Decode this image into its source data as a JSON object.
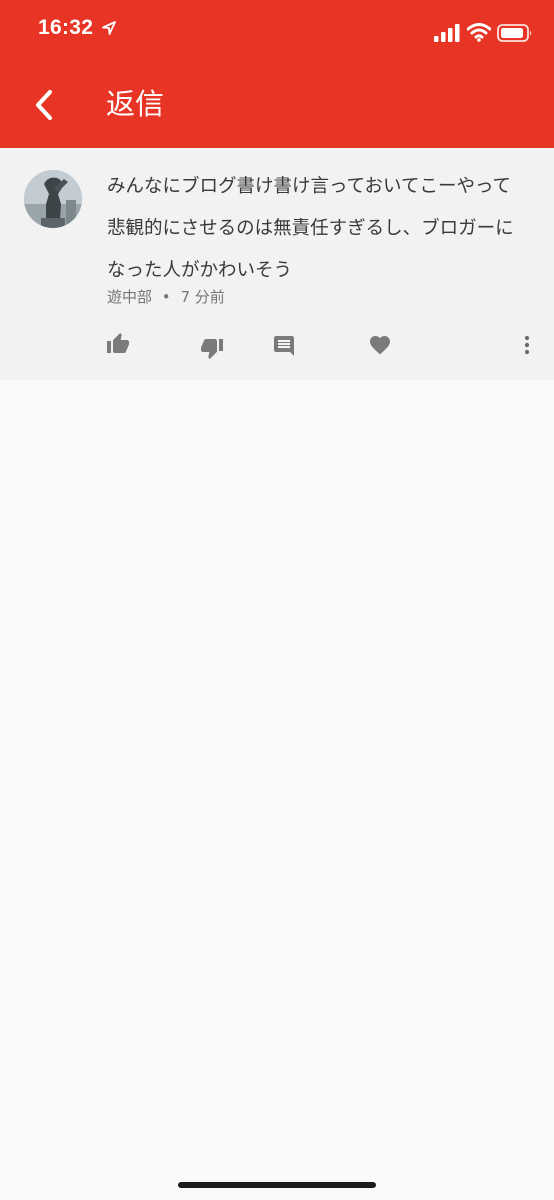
{
  "status_bar": {
    "time": "16:32",
    "icons": [
      "location-arrow-icon",
      "cellular-signal-icon",
      "wifi-icon",
      "battery-icon"
    ]
  },
  "app_bar": {
    "back_icon": "chevron-left-icon",
    "title": "返信"
  },
  "comment": {
    "avatar_icon": "user-avatar",
    "text": "みんなにブログ書け書け言っておいてこーやって悲観的にさせるのは無責任すぎるし、ブロガーになった人がかわいそう",
    "author": "遊中部",
    "separator": "•",
    "time_ago": "7 分前",
    "actions": [
      "thumb-up-icon",
      "thumb-down-icon",
      "reply-icon",
      "heart-icon",
      "more-vert-icon"
    ]
  },
  "colors": {
    "header_red": "#e83424",
    "card_bg": "#f2f2f2",
    "page_bg": "#fafafa",
    "icon_gray": "#7a7a7a"
  }
}
